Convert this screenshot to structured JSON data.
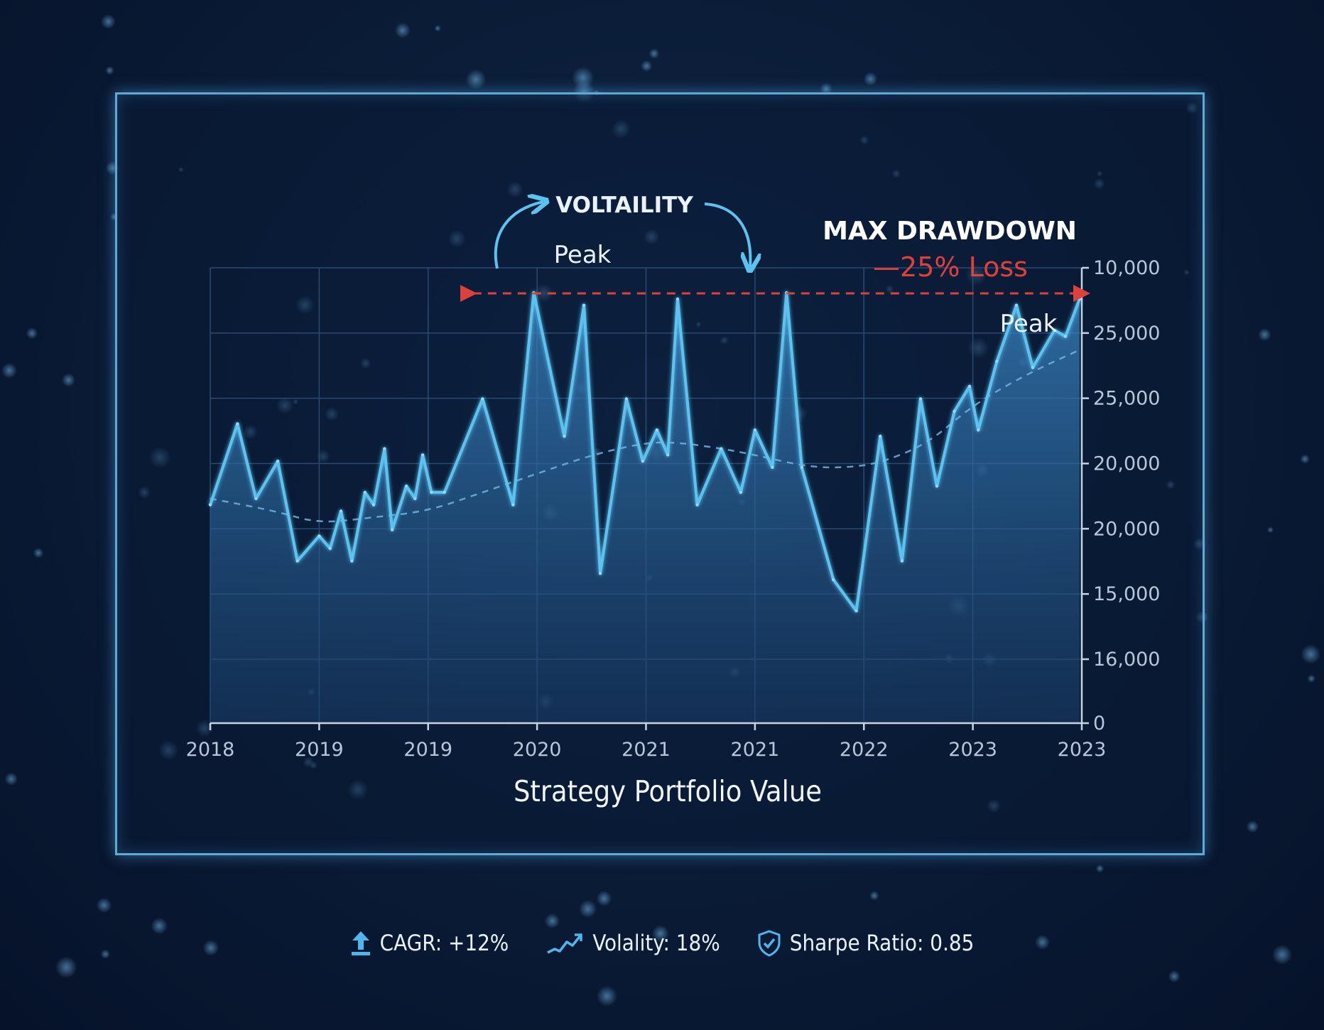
{
  "colors": {
    "line": "#5cc3f0",
    "trend": "#6fb3e0",
    "area_top": "#2f6ea8",
    "drawdown": "#e0403a",
    "text": "#e9f1fb",
    "axis_text": "#b9c6d8"
  },
  "annotations": {
    "volatility": "VOLTAILITY",
    "peak_left": "Peak",
    "peak_right": "Peak",
    "max_drawdown": "MAX DRAWDOWN",
    "drawdown_loss": "—25% Loss"
  },
  "metrics": [
    {
      "icon": "upload-arrow-icon",
      "label": "CAGR: +12%"
    },
    {
      "icon": "trend-line-icon",
      "label": "Volality: 18%"
    },
    {
      "icon": "shield-check-icon",
      "label": "Sharpe Ratio: 0.85"
    }
  ],
  "chart_data": {
    "type": "line",
    "title": "",
    "xlabel": "Strategy Portfolio Value",
    "ylabel": "",
    "x_tick_labels": [
      "2018",
      "2019",
      "2019",
      "2020",
      "2021",
      "2021",
      "2022",
      "2023",
      "2023"
    ],
    "y_tick_labels": [
      "10,000",
      "25,000",
      "25,000",
      "20,000",
      "20,000",
      "15,000",
      "16,000",
      "0"
    ],
    "y_axis_position": "right",
    "grid": true,
    "series": [
      {
        "style": "solid-with-area",
        "x": [
          0,
          0.25,
          0.42,
          0.62,
          0.8,
          1.0,
          1.1,
          1.2,
          1.3,
          1.42,
          1.5,
          1.6,
          1.67,
          1.8,
          1.88,
          1.95,
          2.03,
          2.15,
          2.5,
          2.78,
          2.97,
          3.25,
          3.43,
          3.58,
          3.82,
          3.97,
          4.1,
          4.2,
          4.29,
          4.47,
          4.69,
          4.87,
          5.0,
          5.16,
          5.29,
          5.43,
          5.72,
          5.93,
          6.15,
          6.35,
          6.52,
          6.67,
          6.83,
          6.97,
          7.05,
          7.22,
          7.4,
          7.55,
          7.75,
          7.85,
          7.98
        ],
        "y": [
          18.8,
          20.1,
          18.9,
          19.5,
          17.9,
          18.3,
          18.1,
          18.7,
          17.9,
          19.0,
          18.8,
          19.7,
          18.4,
          19.1,
          18.9,
          19.6,
          19.0,
          19.0,
          20.5,
          18.8,
          22.2,
          19.9,
          22.0,
          17.7,
          20.5,
          19.5,
          20.0,
          19.6,
          22.1,
          18.8,
          19.7,
          19.0,
          20.0,
          19.4,
          22.2,
          19.4,
          17.6,
          17.1,
          19.9,
          17.9,
          20.5,
          19.1,
          20.3,
          20.7,
          20.0,
          21.1,
          22.0,
          21.0,
          21.6,
          21.5,
          22.1
        ]
      },
      {
        "style": "dashed-trend",
        "x": [
          0,
          0.6,
          1.0,
          1.5,
          2.0,
          2.5,
          3.0,
          3.5,
          4.0,
          4.3,
          4.7,
          5.0,
          5.5,
          5.9,
          6.2,
          6.6,
          7.0,
          7.5,
          8.0
        ],
        "y": [
          18.9,
          18.7,
          18.5,
          18.6,
          18.7,
          19.0,
          19.3,
          19.6,
          19.8,
          19.8,
          19.7,
          19.6,
          19.4,
          19.4,
          19.5,
          19.8,
          20.4,
          20.9,
          21.3
        ]
      }
    ],
    "drawdown_range_x": [
      2.32,
      8.0
    ],
    "peak_points": [
      [
        3.25,
        22.2
      ],
      [
        7.98,
        22.1
      ]
    ]
  }
}
